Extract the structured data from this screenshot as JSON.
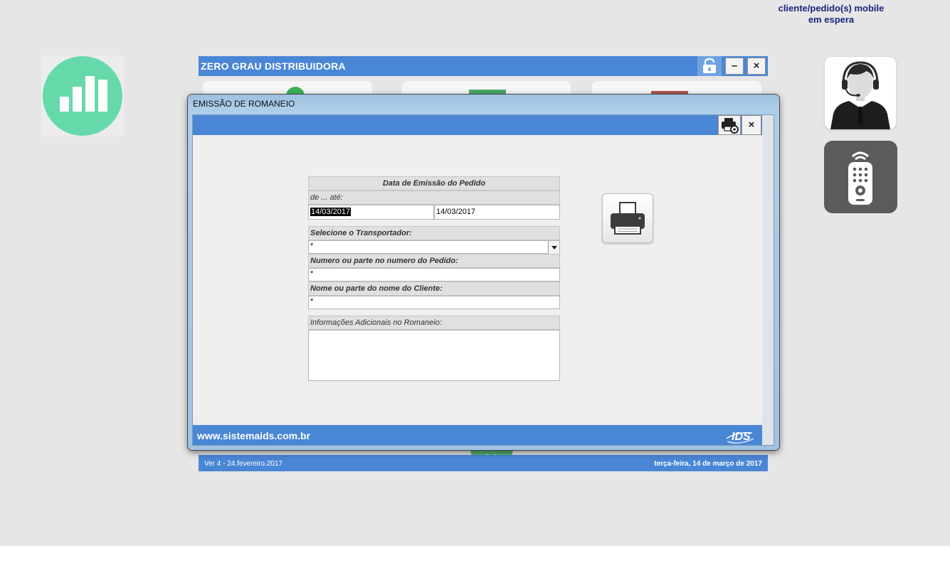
{
  "notification": {
    "line1": "cliente/pedido(s) mobile",
    "line2": "em espera"
  },
  "main_window": {
    "title": "ZERO GRAU DISTRIBUIDORA",
    "minimize_label": "–",
    "close_label": "×"
  },
  "footer": {
    "version": "Ver 4  - 24.fevereiro.2017",
    "date": "terça-feira, 14 de março de 2017"
  },
  "dialog": {
    "title": "EMISSÃO DE ROMANEIO",
    "close_label": "×",
    "website": "www.sistemaids.com.br",
    "logo_text": "IDS"
  },
  "form": {
    "date_section_title": "Data de Emissão do Pedido",
    "date_range_label": "de ... até:",
    "date_from": "14/03/2017",
    "date_to": "14/03/2017",
    "transporter_label": "Selecione o Transportador:",
    "transporter_value": "*",
    "order_label": "Numero ou parte no numero do Pedido:",
    "order_value": "*",
    "client_label": "Nome ou parte do nome do Cliente:",
    "client_value": "*",
    "additional_label": "Informações Adicionais no Romaneio:",
    "additional_value": ""
  },
  "colors": {
    "header_blue": "#4a86d6",
    "chart_green": "#66d9ab",
    "notification_text": "#1a237e"
  },
  "icons": [
    "bar-chart-icon",
    "lock-icon",
    "agent-headset-icon",
    "remote-control-icon",
    "printer-settings-icon",
    "printer-icon",
    "ids-logo"
  ]
}
